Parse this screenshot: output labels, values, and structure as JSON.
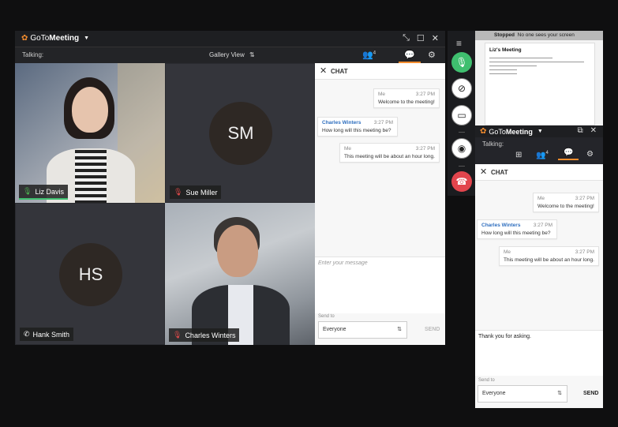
{
  "main": {
    "app_name_light": "GoTo",
    "app_name_bold": "Meeting",
    "talking_label": "Talking:",
    "view_label": "Gallery View",
    "attendee_count": "4",
    "participants": [
      {
        "name": "Liz Davis",
        "initials": "",
        "mic": "mic-on"
      },
      {
        "name": "Sue Miller",
        "initials": "SM",
        "mic": "mic-muted"
      },
      {
        "name": "Hank Smith",
        "initials": "HS",
        "mic": "phone"
      },
      {
        "name": "Charles Winters",
        "initials": "",
        "mic": "mic-muted"
      }
    ],
    "chat": {
      "title": "CHAT",
      "messages": [
        {
          "sender": "Me",
          "time": "3:27 PM",
          "text": "Welcome to the meeting!"
        },
        {
          "sender": "Charles Winters",
          "time": "3:27 PM",
          "text": "How long will this meeting be?"
        },
        {
          "sender": "Me",
          "time": "3:27 PM",
          "text": "This meeting will be about an hour long."
        }
      ],
      "compose_placeholder": "Enter your message",
      "send_to_label": "Send to",
      "send_to_value": "Everyone",
      "send_label": "SEND"
    }
  },
  "secondary": {
    "status_label": "Stopped",
    "status_text": "No one sees your screen",
    "shared_doc_title": "Liz's Meeting",
    "app_name_light": "GoTo",
    "app_name_bold": "Meeting",
    "talking_label": "Talking:",
    "attendee_count": "4",
    "chat": {
      "title": "CHAT",
      "messages": [
        {
          "sender": "Me",
          "time": "3:27 PM",
          "text": "Welcome to the meeting!"
        },
        {
          "sender": "Charles Winters",
          "time": "3:27 PM",
          "text": "How long will this meeting be?"
        },
        {
          "sender": "Me",
          "time": "3:27 PM",
          "text": "This meeting will be about an hour long."
        }
      ],
      "compose_value": "Thank you for asking.",
      "send_to_label": "Send to",
      "send_to_value": "Everyone",
      "send_label": "SEND"
    }
  },
  "colors": {
    "brand_orange": "#f68d2e",
    "mic_green": "#3fbf6f",
    "end_red": "#e2454d",
    "sender_blue": "#2f6fbf"
  }
}
